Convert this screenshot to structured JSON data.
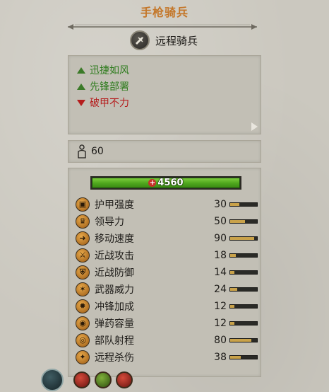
{
  "unit": {
    "name": "手枪骑兵",
    "type_label": "远程骑兵",
    "type_icon": "ranged-cavalry-icon"
  },
  "traits": [
    {
      "label": "迅捷如风",
      "kind": "positive",
      "icon": "triangle-up-icon",
      "color": "#2f7c1e"
    },
    {
      "label": "先锋部署",
      "kind": "positive",
      "icon": "triangle-up-icon",
      "color": "#2f7c1e"
    },
    {
      "label": "破甲不力",
      "kind": "negative",
      "icon": "triangle-down-icon",
      "color": "#b51d1d"
    }
  ],
  "men": {
    "value": "60",
    "icon": "soldier-icon"
  },
  "health": {
    "value": "4560",
    "fill": 1.0,
    "color": "#5fb52a"
  },
  "stats": [
    {
      "label": "护甲强度",
      "value": "30",
      "fill": 0.35,
      "icon": "armor-icon"
    },
    {
      "label": "领导力",
      "value": "50",
      "fill": 0.55,
      "icon": "leadership-icon"
    },
    {
      "label": "移动速度",
      "value": "90",
      "fill": 0.9,
      "icon": "speed-icon"
    },
    {
      "label": "近战攻击",
      "value": "18",
      "fill": 0.2,
      "icon": "melee-attack-icon"
    },
    {
      "label": "近战防御",
      "value": "14",
      "fill": 0.17,
      "icon": "melee-defense-icon"
    },
    {
      "label": "武器威力",
      "value": "24",
      "fill": 0.25,
      "icon": "weapon-strength-icon"
    },
    {
      "label": "冲锋加成",
      "value": "12",
      "fill": 0.15,
      "icon": "charge-bonus-icon"
    },
    {
      "label": "弹药容量",
      "value": "12",
      "fill": 0.15,
      "icon": "ammunition-icon"
    },
    {
      "label": "部队射程",
      "value": "80",
      "fill": 0.8,
      "icon": "range-icon"
    },
    {
      "label": "远程杀伤",
      "value": "38",
      "fill": 0.4,
      "icon": "missile-damage-icon"
    }
  ],
  "abilities": [
    {
      "icon": "faction-emblem-icon"
    },
    {
      "icon": "attribute-fire-icon"
    },
    {
      "icon": "attribute-eye-icon"
    },
    {
      "icon": "attribute-speed-icon"
    }
  ]
}
